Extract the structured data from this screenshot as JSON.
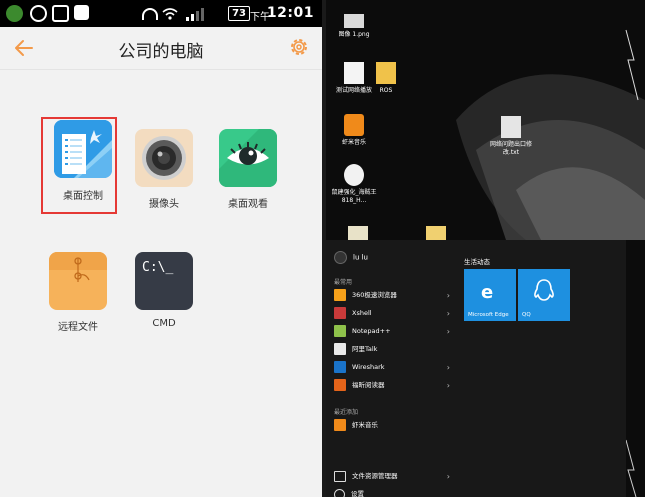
{
  "phone": {
    "status_bar": {
      "battery": "73",
      "ampm": "下午",
      "time": "12:01"
    },
    "header": {
      "title": "公司的电脑"
    },
    "apps": [
      {
        "label": "桌面控制"
      },
      {
        "label": "摄像头"
      },
      {
        "label": "桌面观看"
      },
      {
        "label": "远程文件"
      },
      {
        "label": "CMD"
      }
    ],
    "cmd_prompt": "C:\\_",
    "colors": {
      "accent": "#f39a4a",
      "highlight": "#e53935"
    }
  },
  "desktop": {
    "icons": [
      {
        "label": "图像 1.png"
      },
      {
        "label": "测试网络播放"
      },
      {
        "label": "ROS"
      },
      {
        "label": "虾米音乐"
      },
      {
        "label": "网络问题出口修改.txt"
      },
      {
        "label": "鼠建强化_海贼王818_H..."
      }
    ],
    "start_menu": {
      "user": "lu lu",
      "most_used_title": "最常用",
      "most_used": [
        {
          "label": "360极速浏览器",
          "has_arrow": true
        },
        {
          "label": "Xshell",
          "has_arrow": true
        },
        {
          "label": "Notepad++",
          "has_arrow": true
        },
        {
          "label": "阿里Talk",
          "has_arrow": false
        },
        {
          "label": "Wireshark",
          "has_arrow": true
        },
        {
          "label": "福昕阅读器",
          "has_arrow": true
        }
      ],
      "recent_title": "最近添加",
      "recent": [
        {
          "label": "虾米音乐"
        }
      ],
      "bottom": [
        {
          "label": "文件资源管理器"
        },
        {
          "label": "设置"
        }
      ],
      "tiles_title": "生活动态",
      "tiles": [
        {
          "label": "Microsoft Edge"
        },
        {
          "label": "QQ"
        }
      ]
    }
  }
}
